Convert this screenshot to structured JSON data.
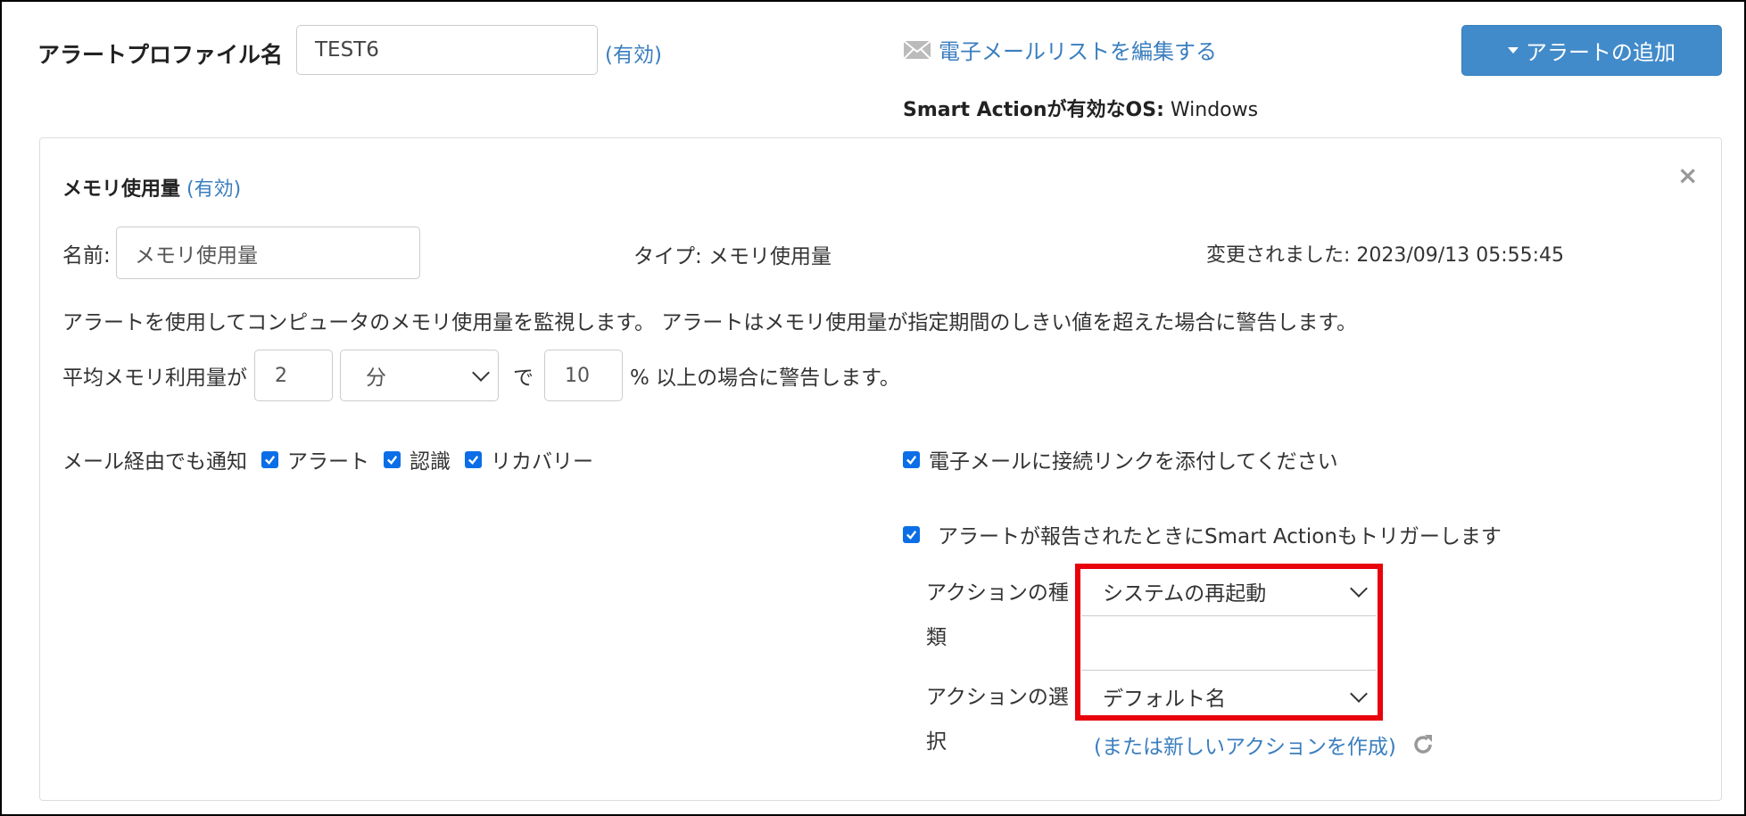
{
  "header": {
    "profile_label": "アラートプロファイル名",
    "profile_name": "TEST6",
    "profile_status": "(有効)",
    "email_edit_label": "電子メールリストを編集する",
    "add_alert_label": "アラートの追加",
    "smart_action_os_label": "Smart Actionが有効なOS:",
    "smart_action_os_value": " Windows"
  },
  "panel": {
    "title": "メモリ使用量",
    "status": "(有効)",
    "close": "×",
    "name_label": "名前:",
    "name_value": "メモリ使用量",
    "type_text": "タイプ: メモリ使用量",
    "modified_text": "変更されました: 2023/09/13 05:55:45",
    "description": "アラートを使用してコンピュータのメモリ使用量を監視します。 アラートはメモリ使用量が指定期間のしきい値を超えた場合に警告します。",
    "threshold": {
      "prefix": "平均メモリ利用量が",
      "duration_value": "2",
      "unit_selected": "分",
      "middle": "で",
      "percent_value": "10",
      "suffix": "% 以上の場合に警告します。"
    },
    "notify": {
      "label": "メール経由でも通知",
      "alert": "アラート",
      "ack": "認識",
      "recovery": "リカバリー"
    },
    "attach_link_label": "電子メールに接続リンクを添付してください",
    "trigger_label": "アラートが報告されたときにSmart Actionもトリガーします",
    "action_type_label": "アクションの種類",
    "action_type_selected": "システムの再起動",
    "action_select_label": "アクションの選択",
    "action_selected": "デフォルト名",
    "create_action_link": "(または新しいアクションを作成)"
  },
  "colors": {
    "accent": "#428bca",
    "link": "#3a7ebf",
    "checkbox": "#0b6ee6",
    "highlight": "#e8000b"
  }
}
